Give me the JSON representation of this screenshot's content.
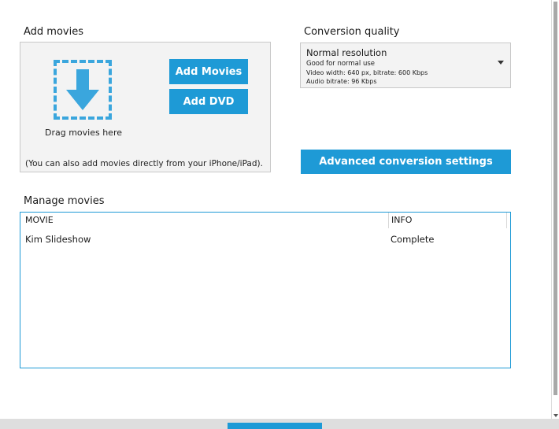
{
  "add_movies": {
    "title": "Add movies",
    "drag_label": "Drag movies here",
    "add_movies_button": "Add Movies",
    "add_dvd_button": "Add DVD",
    "note": "(You can also add movies directly from your iPhone/iPad)."
  },
  "conversion_quality": {
    "title": "Conversion quality",
    "selected": {
      "name": "Normal resolution",
      "description": "Good for normal use",
      "video": "Video width: 640 px, bitrate: 600 Kbps",
      "audio": "Audio bitrate: 96 Kbps"
    },
    "advanced_button": "Advanced conversion settings"
  },
  "manage_movies": {
    "title": "Manage movies",
    "columns": [
      "MOVIE",
      "INFO"
    ],
    "rows": [
      {
        "movie": "Kim Slideshow",
        "info": "Complete"
      }
    ]
  },
  "icons": {
    "drop": "download-arrow-icon",
    "dropdown": "chevron-down-icon"
  },
  "colors": {
    "accent": "#1e9ad6",
    "panel": "#f3f3f3"
  }
}
